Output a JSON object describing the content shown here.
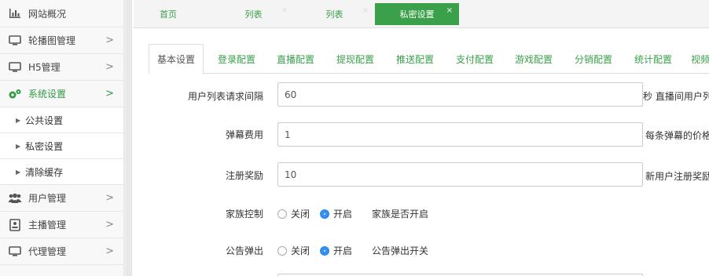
{
  "sidebar": {
    "items": [
      {
        "label": "网站概况",
        "icon": "bar-chart-icon"
      },
      {
        "label": "轮播图管理",
        "icon": "monitor-icon",
        "arrow": ">"
      },
      {
        "label": "H5管理",
        "icon": "monitor-icon",
        "arrow": ">"
      },
      {
        "label": "系统设置",
        "icon": "gears-icon",
        "arrow": ">"
      },
      {
        "label": "用户管理",
        "icon": "users-icon",
        "arrow": ">"
      },
      {
        "label": "主播管理",
        "icon": "id-card-icon",
        "arrow": ">"
      },
      {
        "label": "代理管理",
        "icon": "monitor-icon",
        "arrow": ">"
      }
    ],
    "subitems": [
      "公共设置",
      "私密设置",
      "清除缓存"
    ],
    "active_color": "#2f9a3f"
  },
  "pagetabs": [
    {
      "label": "首页"
    },
    {
      "label": "列表",
      "close": "×"
    },
    {
      "label": "列表",
      "close": "×"
    },
    {
      "label": "私密设置",
      "close": "×"
    }
  ],
  "settings_tabs": [
    "基本设置",
    "登录配置",
    "直播配置",
    "提现配置",
    "推送配置",
    "支付配置",
    "游戏配置",
    "分销配置",
    "统计配置",
    "视频"
  ],
  "form": {
    "fields": [
      {
        "label": "用户列表请求间隔",
        "value": "60",
        "hint": "秒 直播间用户列"
      },
      {
        "label": "弹幕费用",
        "value": "1",
        "hint": "每条弹幕的价格"
      },
      {
        "label": "注册奖励",
        "value": "10",
        "hint": "新用户注册奖励"
      }
    ],
    "radios": [
      {
        "label": "家族控制",
        "off": "关闭",
        "on": "开启",
        "hint": "家族是否开启",
        "selected": "on"
      },
      {
        "label": "公告弹出",
        "off": "关闭",
        "on": "开启",
        "hint": "公告弹出开关",
        "selected": "on"
      }
    ]
  },
  "colors": {
    "accent": "#3aa04a",
    "radio": "#2d8cf0"
  }
}
